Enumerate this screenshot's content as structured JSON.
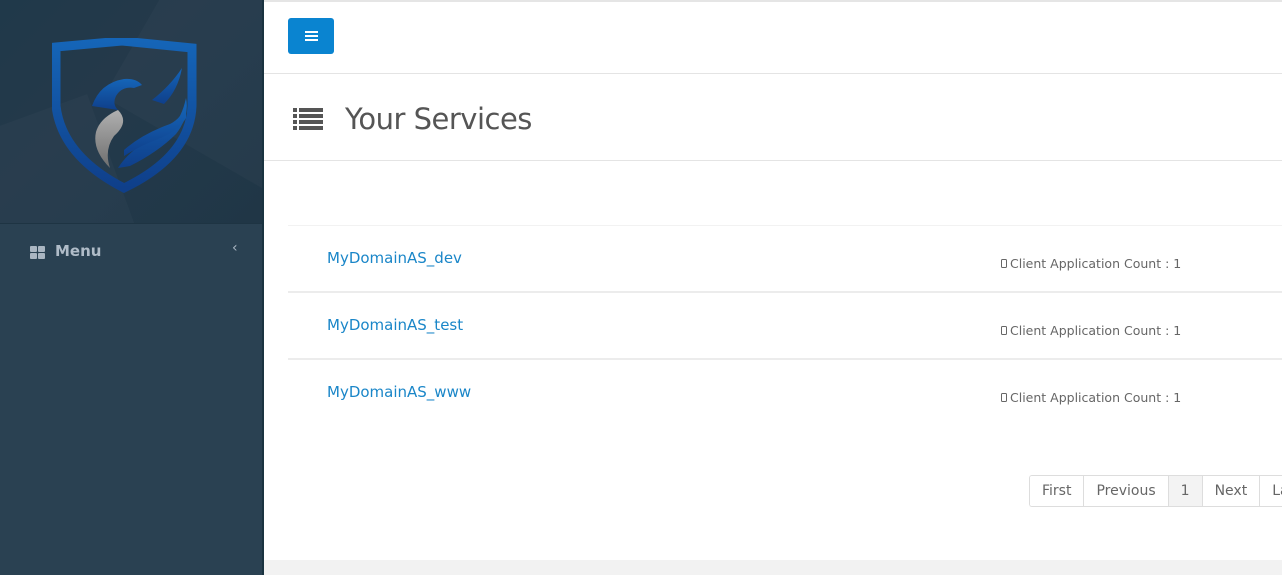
{
  "sidebar": {
    "logo": "shield-griffin-logo",
    "menu_label": "Menu",
    "menu_icon": "grid-icon",
    "collapse_icon": "chevron-left-icon",
    "colors": {
      "background": "#2a4152",
      "logo_area": "#22394a",
      "text": "#b0bcc8"
    }
  },
  "topbar": {
    "toggle_icon": "hamburger-icon",
    "toggle_color": "#0a84d0"
  },
  "page": {
    "title": "Your Services",
    "title_icon": "list-icon"
  },
  "services": [
    {
      "name": "MyDomainAS_dev",
      "count_label": "Client Application Count : 1",
      "icon": "mobile-icon"
    },
    {
      "name": "MyDomainAS_test",
      "count_label": "Client Application Count : 1",
      "icon": "mobile-icon"
    },
    {
      "name": "MyDomainAS_www",
      "count_label": "Client Application Count : 1",
      "icon": "mobile-icon"
    }
  ],
  "pagination": {
    "first": "First",
    "previous": "Previous",
    "current": "1",
    "next": "Next",
    "last": "La"
  },
  "colors": {
    "link": "#1a86c8",
    "accent": "#0a84d0"
  }
}
